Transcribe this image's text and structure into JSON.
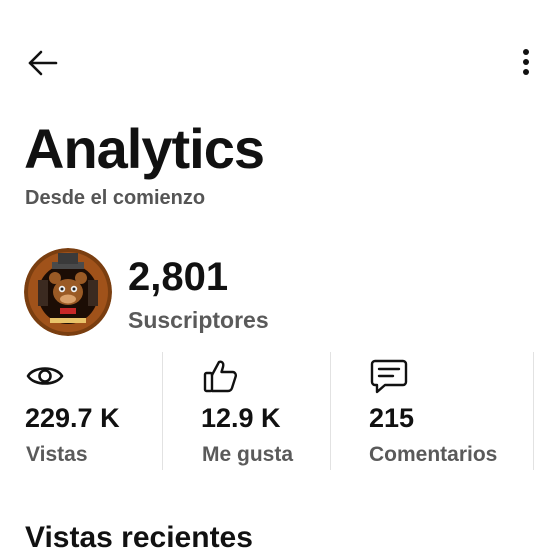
{
  "header": {
    "back_icon": "arrow-left-icon",
    "more_icon": "more-vertical-icon"
  },
  "page": {
    "title": "Analytics",
    "subtitle": "Desde el comienzo"
  },
  "channel": {
    "avatar_icon": "channel-avatar-icon",
    "subscribers_value": "2,801",
    "subscribers_label": "Suscriptores"
  },
  "stats": [
    {
      "icon": "eye-icon",
      "value": "229.7 K",
      "label": "Vistas"
    },
    {
      "icon": "thumbs-up-icon",
      "value": "12.9 K",
      "label": "Me gusta"
    },
    {
      "icon": "comment-icon",
      "value": "215",
      "label": "Comentarios"
    }
  ],
  "sections": {
    "recent_views_title": "Vistas recientes"
  },
  "colors": {
    "text_primary": "#111111",
    "text_secondary": "#5a5a5a",
    "divider": "#e2e2e2",
    "background": "#ffffff"
  }
}
